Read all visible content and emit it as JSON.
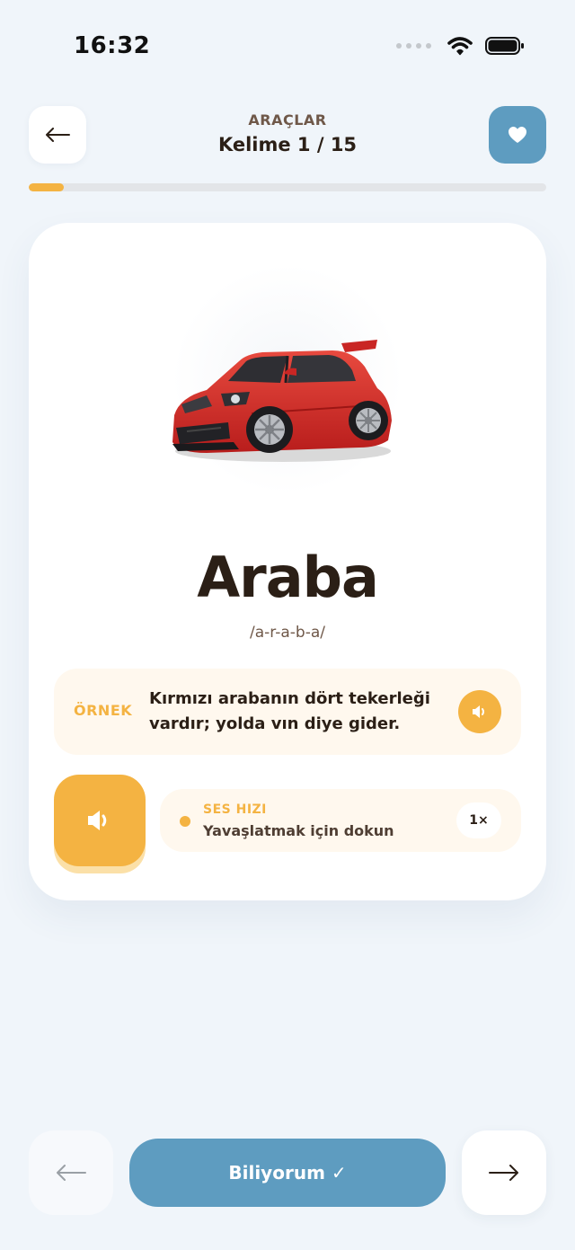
{
  "status_bar": {
    "time": "16:32"
  },
  "header": {
    "category": "ARAÇLAR",
    "counter": "Kelime 1 / 15"
  },
  "progress": {
    "current": 1,
    "total": 15,
    "fraction": 0.067
  },
  "card": {
    "word": "Araba",
    "phonetic": "/a-r-a-b-a/",
    "example": {
      "label": "ÖRNEK",
      "text": "Kırmızı arabanın dört tekerleği vardır; yolda vın diye gider."
    },
    "speed": {
      "title": "SES HIZI",
      "hint": "Yavaşlatmak için dokun",
      "value": "1×"
    }
  },
  "bottom_nav": {
    "know_label": "Biliyorum ✓"
  },
  "colors": {
    "accent_orange": "#f4b342",
    "accent_blue": "#5e9cc0",
    "background": "#f0f5fa",
    "car_red": "#d92b28"
  },
  "icons": {
    "back": "arrow-left-icon",
    "favorite": "heart-icon",
    "audio": "speaker-icon",
    "prev": "arrow-left-icon",
    "next": "arrow-right-icon"
  }
}
